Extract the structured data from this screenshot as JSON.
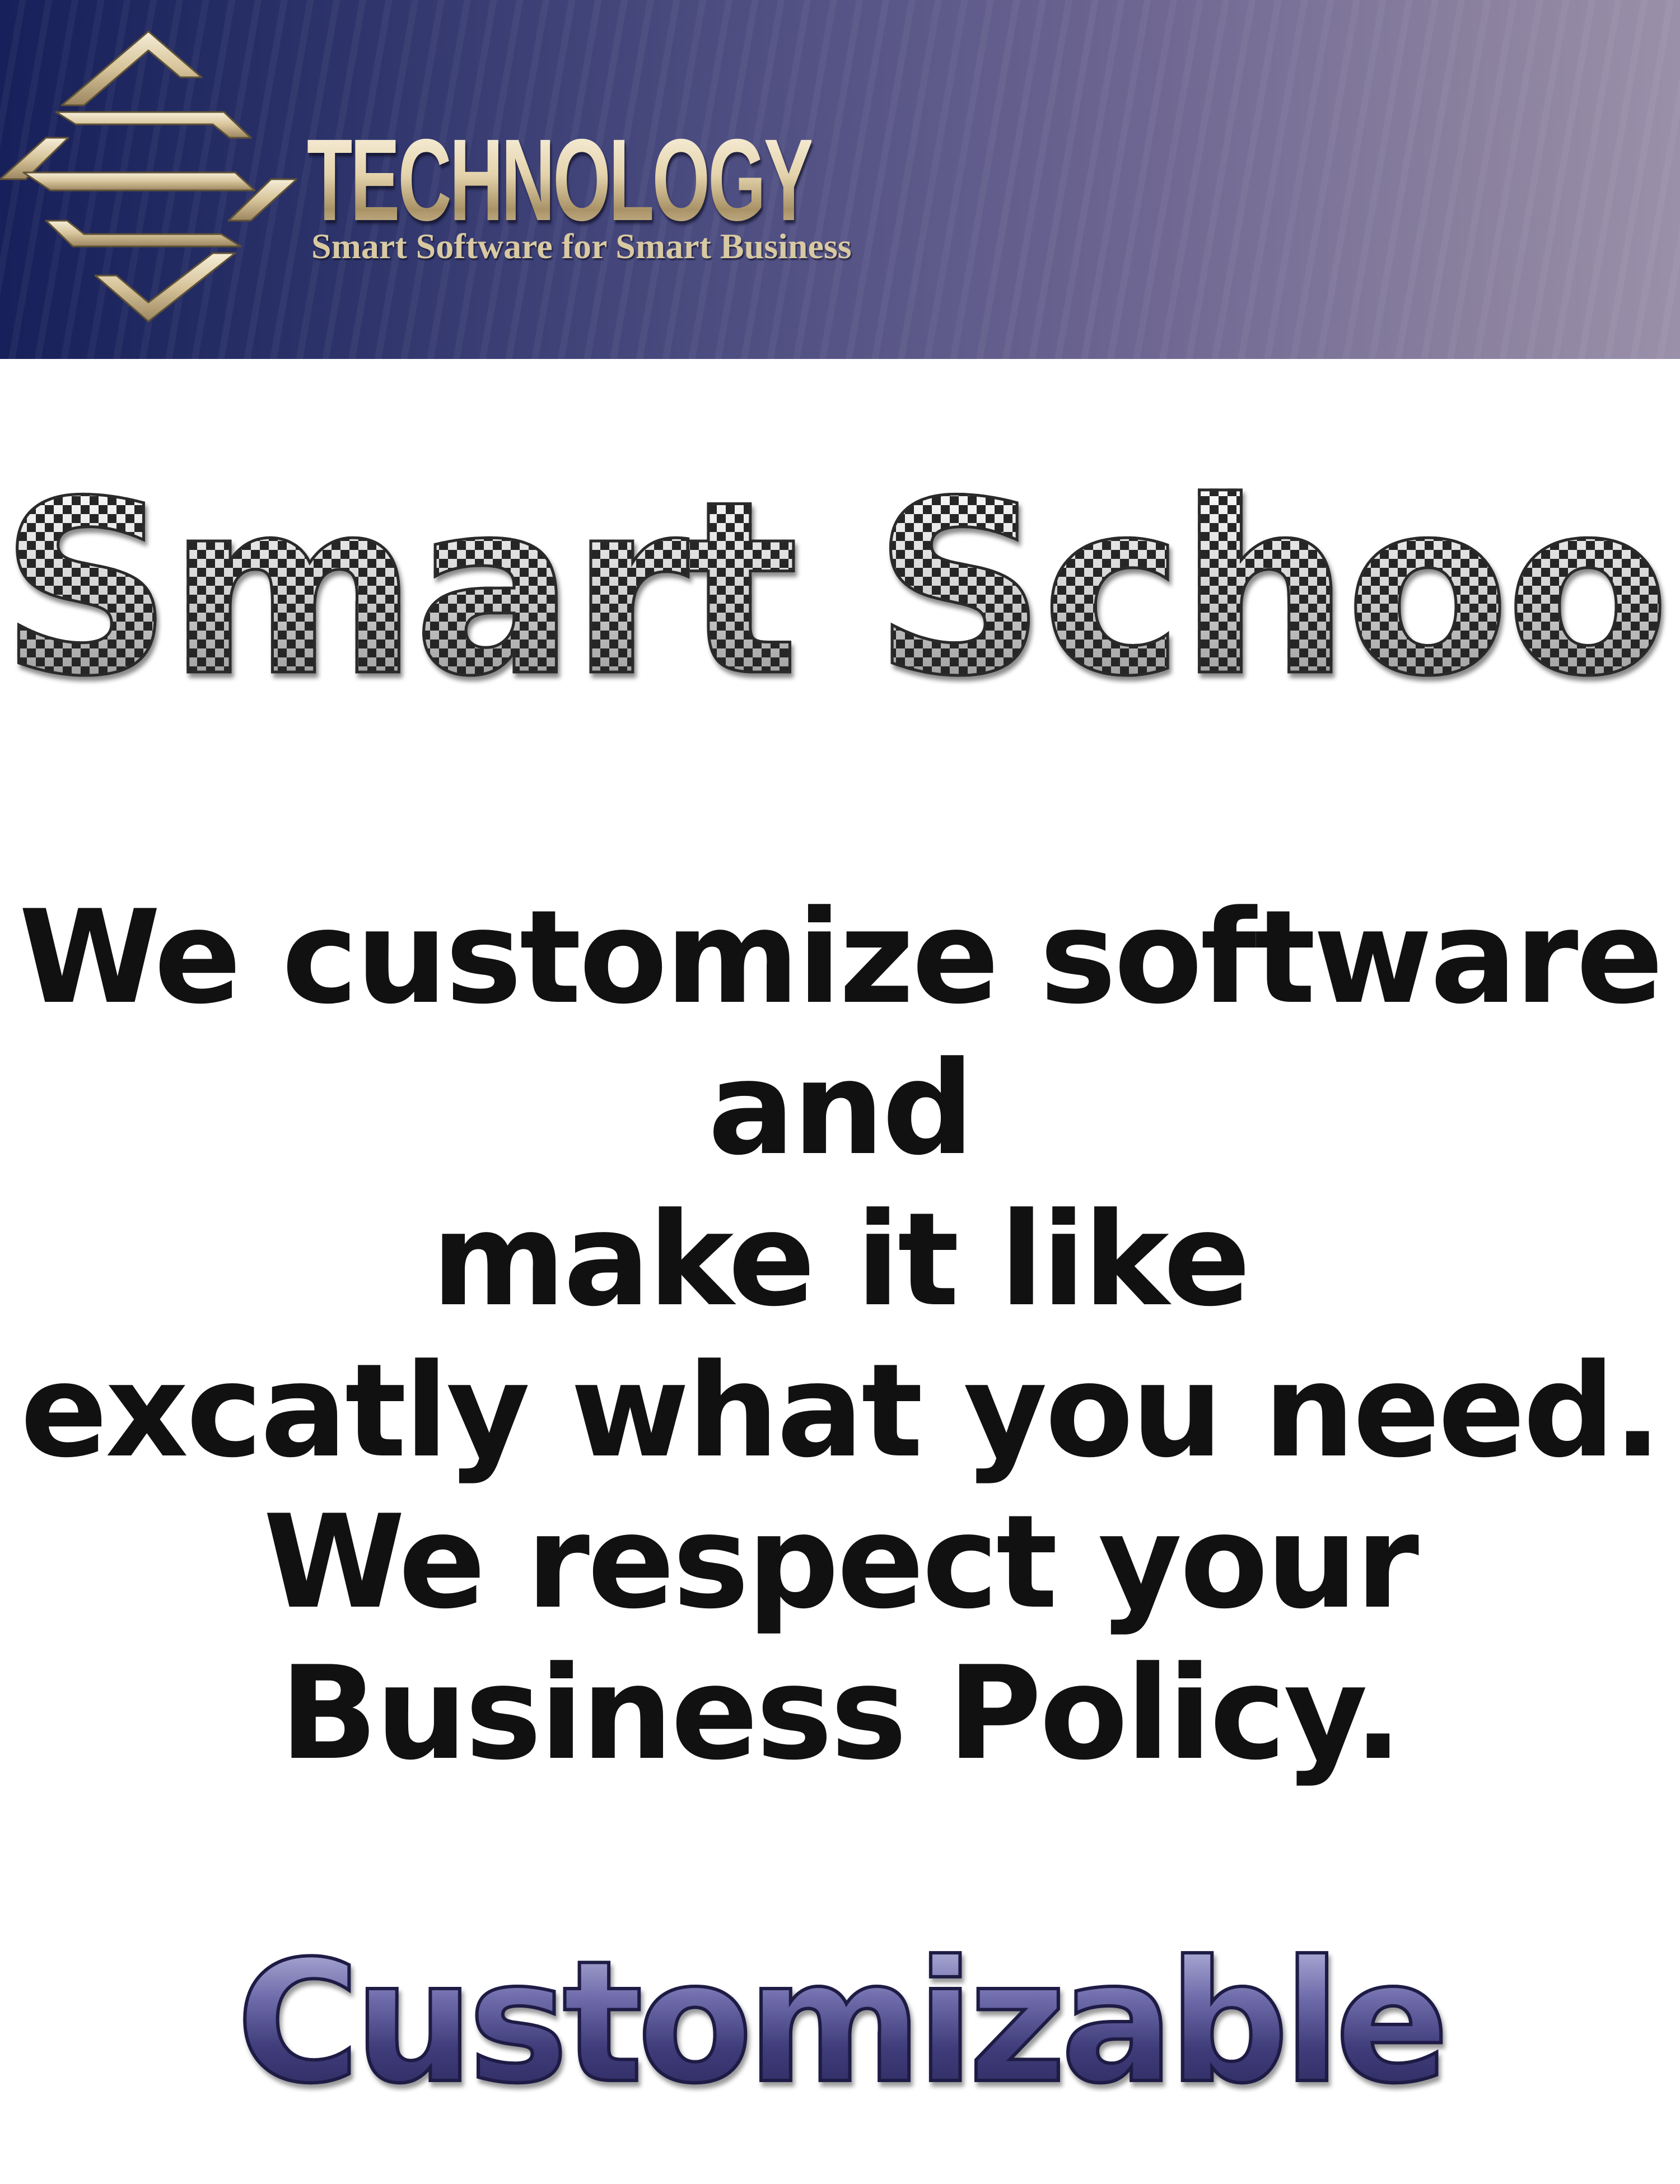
{
  "header": {
    "brand_word": "TECHNOLOGY",
    "tagline": "Smart Software for Smart Business",
    "logo_icon": "diamond-s-logo-icon",
    "band_colors": [
      "#17205a",
      "#6e6692",
      "#9a90aa"
    ],
    "gold_color": "#e4d3ac"
  },
  "product_title": "Smart School",
  "message": {
    "lines": [
      "We customize software",
      "and",
      "make it like",
      "excatly what you need.",
      "We respect your",
      "Business Policy."
    ],
    "color": "#111111"
  },
  "footer_word": "Customizable",
  "footer_color": "#4a4788"
}
